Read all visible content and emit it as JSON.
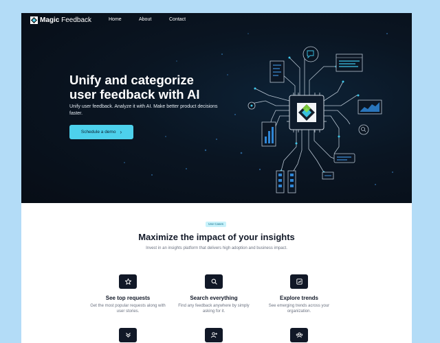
{
  "nav": {
    "brand_bold": "Magic",
    "brand_light": "Feedback",
    "links": [
      "Home",
      "About",
      "Contact"
    ]
  },
  "hero": {
    "title_line1": "Unify and categorize",
    "title_line2": "user feedback with AI",
    "subtitle": "Unify user feedback. Analyze it with AI. Make better product decisions faster.",
    "cta_label": "Schedule a demo",
    "cta_icon": "chevron-right-icon"
  },
  "use_cases": {
    "badge": "Use Cases",
    "title": "Maximize the impact of your insights",
    "subtitle": "Invest in an insights platform that delivers high adoption and business impact.",
    "features": [
      {
        "icon": "star-icon",
        "title": "See top requests",
        "desc": "Get the most popular requests along with user stories."
      },
      {
        "icon": "search-icon",
        "title": "Search everything",
        "desc": "Find any feedback anywhere by simply asking for it."
      },
      {
        "icon": "chart-icon",
        "title": "Explore trends",
        "desc": "See emerging trends across your organization."
      }
    ],
    "more_icons": [
      "double-chevron-down-icon",
      "user-plus-icon",
      "group-icon"
    ]
  },
  "colors": {
    "background": "#b3dcf7",
    "hero_bg": "#0a1522",
    "accent": "#4dd1ec",
    "icon_tile": "#111827"
  }
}
